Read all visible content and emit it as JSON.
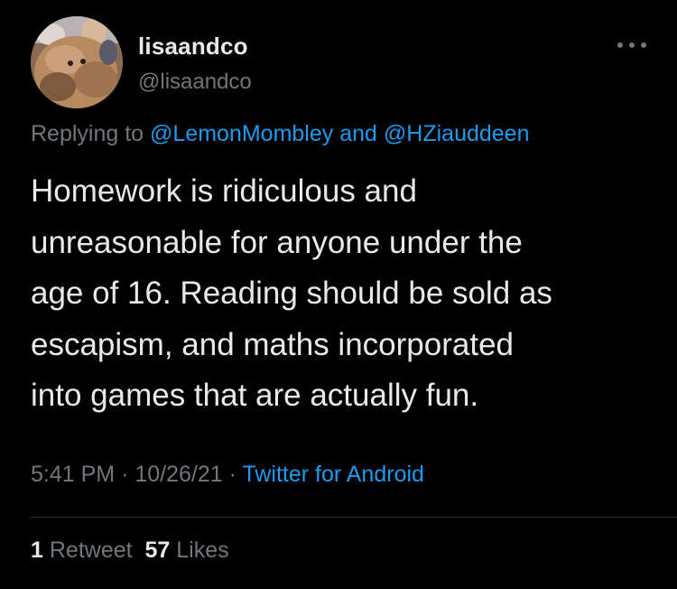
{
  "author": {
    "display_name": "lisaandco",
    "handle": "@lisaandco"
  },
  "reply": {
    "prefix": "Replying to",
    "mention_1": "@LemonMombley",
    "conjunction": "and",
    "mention_2": "@HZiauddeen"
  },
  "tweet": {
    "text": "Homework is ridiculous and\nunreasonable for anyone under the\nage of 16. Reading should be sold as\nescapism, and maths incorporated\ninto games that are actually fun."
  },
  "meta": {
    "time": "5:41 PM",
    "separator": "·",
    "date": "10/26/21",
    "source": "Twitter for Android"
  },
  "stats": {
    "retweets_count": "1",
    "retweets_label": "Retweet",
    "likes_count": "57",
    "likes_label": "Likes"
  },
  "icons": {
    "more": "more-horizontal-icon"
  },
  "colors": {
    "background": "#000000",
    "primary_text": "#e7e9ea",
    "secondary_text": "#71767b",
    "accent": "#1d9bf0",
    "divider": "#2f3336"
  }
}
